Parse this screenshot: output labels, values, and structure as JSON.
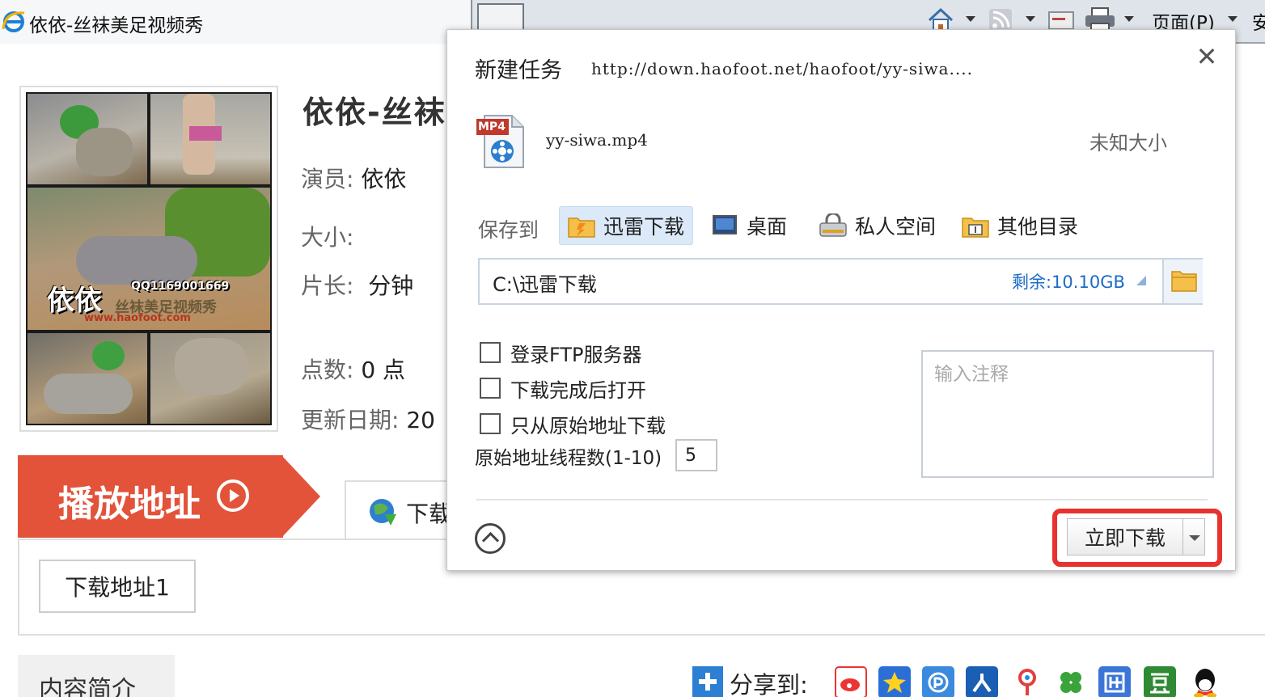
{
  "browser": {
    "tab_title": "依依-丝袜美足视频秀",
    "page_menu": "页面(P)",
    "extra_label": "安"
  },
  "page": {
    "title": "依依-丝袜",
    "actor_label": "演员:",
    "actor_value": "依依",
    "size_label": "大小:",
    "length_label": "片长:",
    "length_value": "分钟",
    "points_label": "点数:",
    "points_value": "0 点",
    "update_label": "更新日期:",
    "update_value": "20",
    "watermark_name": "依依",
    "watermark_qq": "QQ1169001669",
    "watermark_sub": "丝袜美足视频秀",
    "watermark_url": "www.haofoot.com",
    "play_label": "播放地址",
    "download_tab": "下载",
    "download_link": "下载地址1",
    "intro_tab": "内容简介",
    "share_label": "分享到:",
    "share_icons": [
      "weibo-icon",
      "qzone-icon",
      "pengyou-icon",
      "renren-icon",
      "tqq-icon",
      "kaixin-icon",
      "tieba-icon",
      "douban-icon",
      "qq-icon"
    ]
  },
  "dialog": {
    "title": "新建任务",
    "url": "http://down.haofoot.net/haofoot/yy-siwa....",
    "close": "✕",
    "file_type": "MP4",
    "file_name": "yy-siwa.mp4",
    "file_size": "未知大小",
    "save_label": "保存到",
    "save_options": [
      {
        "label": "迅雷下载",
        "selected": true
      },
      {
        "label": "桌面",
        "selected": false
      },
      {
        "label": "私人空间",
        "selected": false
      },
      {
        "label": "其他目录",
        "selected": false
      }
    ],
    "path": "C:\\迅雷下载",
    "remaining": "剩余:10.10GB",
    "checkboxes": [
      "登录FTP服务器",
      "下载完成后打开",
      "只从原始地址下载"
    ],
    "threads_label": "原始地址线程数(1-10)",
    "threads_value": "5",
    "note_placeholder": "输入注释",
    "download_button": "立即下载",
    "highlight_color": "#e8322f"
  }
}
